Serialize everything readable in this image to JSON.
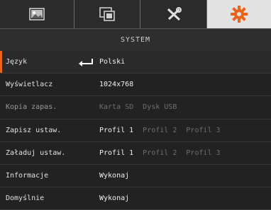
{
  "tabs": [
    {
      "icon": "image-icon"
    },
    {
      "icon": "display-settings-icon"
    },
    {
      "icon": "tools-icon"
    },
    {
      "icon": "gear-icon",
      "active": true,
      "accent": "#e8641e"
    }
  ],
  "header": {
    "title": "SYSTEM"
  },
  "menu": {
    "rows": [
      {
        "label": "Język",
        "values": [
          "Polski"
        ],
        "selected": true
      },
      {
        "label": "Wyświetlacz",
        "values": [
          "1024x768"
        ]
      },
      {
        "label": "Kopia zapas.",
        "values": [
          "Karta SD",
          "Dysk USB"
        ],
        "disabled": true
      },
      {
        "label": "Zapisz ustaw.",
        "values": [
          "Profil 1",
          "Profil 2",
          "Profil 3"
        ]
      },
      {
        "label": "Załaduj ustaw.",
        "values": [
          "Profil 1",
          "Profil 2",
          "Profil 3"
        ]
      },
      {
        "label": "Informacje",
        "values": [
          "Wykonaj"
        ]
      },
      {
        "label": "Domyślnie",
        "values": [
          "Wykonaj"
        ]
      }
    ]
  },
  "colors": {
    "accent": "#e8641e",
    "background": "#1f1f1f"
  }
}
